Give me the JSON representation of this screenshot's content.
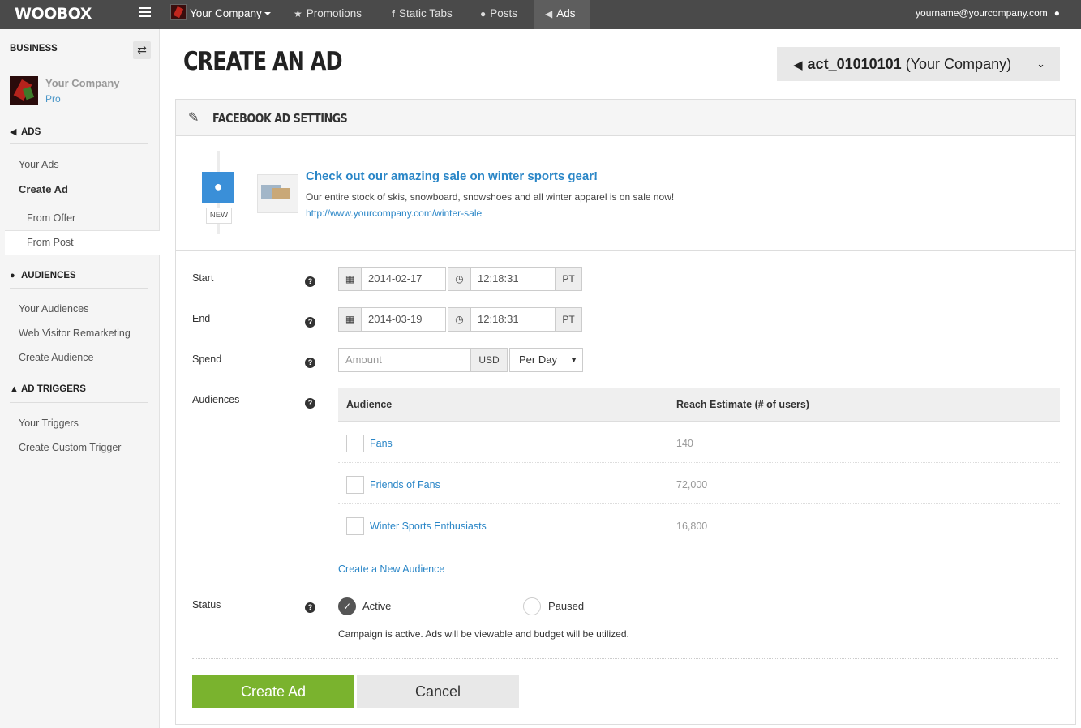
{
  "topnav": {
    "logo": "WOOBOX",
    "company": "Your Company",
    "items": [
      "Promotions",
      "Static Tabs",
      "Posts",
      "Ads"
    ],
    "user_email": "yourname@yourcompany.com"
  },
  "sidebar": {
    "business_label": "BUSINESS",
    "company_name": "Your Company",
    "plan": "Pro",
    "sections": {
      "ads": "ADS",
      "audiences": "AUDIENCES",
      "triggers": "AD TRIGGERS"
    },
    "links": {
      "your_ads": "Your Ads",
      "create_ad": "Create Ad",
      "from_offer": "From Offer",
      "from_post": "From Post",
      "your_audiences": "Your Audiences",
      "web_visitor": "Web Visitor Remarketing",
      "create_audience": "Create Audience",
      "your_triggers": "Your Triggers",
      "create_trigger": "Create Custom Trigger"
    }
  },
  "main": {
    "title": "CREATE AN AD",
    "account_id": "act_01010101",
    "account_name": "(Your Company)",
    "panel_title": "FACEBOOK AD SETTINGS",
    "post": {
      "badge": "NEW",
      "title": "Check out our amazing sale on winter sports gear!",
      "description": "Our entire stock of skis, snowboard, snowshoes and all winter apparel is on sale now!",
      "url": "http://www.yourcompany.com/winter-sale"
    },
    "form": {
      "start_label": "Start",
      "start_date": "2014-02-17",
      "start_time": "12:18:31",
      "end_label": "End",
      "end_date": "2014-03-19",
      "end_time": "12:18:31",
      "tz": "PT",
      "spend_label": "Spend",
      "amount_placeholder": "Amount",
      "currency": "USD",
      "period": "Per Day",
      "audiences_label": "Audiences",
      "status_label": "Status"
    },
    "audiences": {
      "col_audience": "Audience",
      "col_reach": "Reach Estimate (# of users)",
      "rows": [
        {
          "name": "Fans",
          "reach": "140"
        },
        {
          "name": "Friends of Fans",
          "reach": "72,000"
        },
        {
          "name": "Winter Sports Enthusiasts",
          "reach": "16,800"
        }
      ],
      "create_new": "Create a New Audience"
    },
    "status": {
      "active": "Active",
      "paused": "Paused",
      "note": "Campaign is active. Ads will be viewable and budget will be utilized."
    },
    "buttons": {
      "create": "Create Ad",
      "cancel": "Cancel"
    }
  },
  "colors": {
    "topbar": "#4a4a4a",
    "link": "#2a86c7",
    "primary_button": "#7ab32e",
    "post_badge": "#3a8fd8"
  }
}
